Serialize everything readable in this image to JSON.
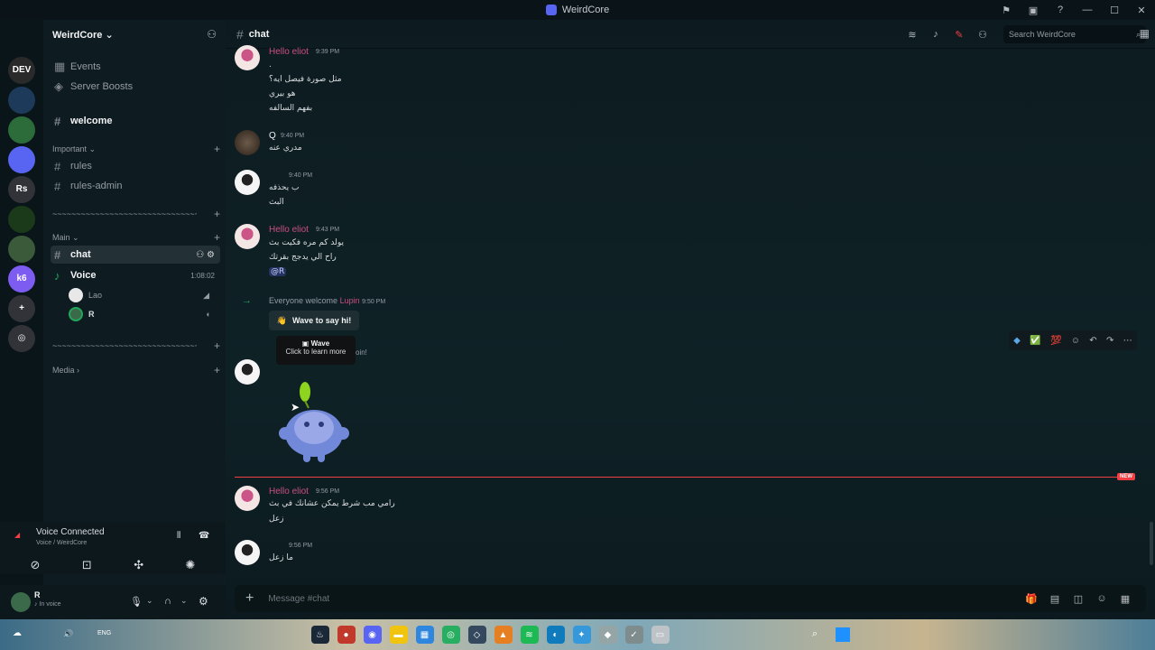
{
  "window": {
    "title": "WeirdCore"
  },
  "rail": {
    "servers": [
      {
        "name": "discord-home",
        "label": "",
        "color": "#0a1519"
      },
      {
        "name": "server-dev",
        "label": "DEV",
        "color": "#2a2a2a"
      },
      {
        "name": "server-lightning",
        "label": "",
        "color": "#1d3a5a"
      },
      {
        "name": "server-green",
        "label": "",
        "color": "#2c6b3a"
      },
      {
        "name": "server-bot",
        "label": "",
        "color": "#5865f2"
      },
      {
        "name": "server-rs",
        "label": "Rs",
        "color": "#313338"
      },
      {
        "name": "server-ring",
        "label": "",
        "color": "#1a3a1a"
      },
      {
        "name": "server-landscape",
        "label": "",
        "color": "#3a5a3a"
      },
      {
        "name": "server-k6",
        "label": "k6",
        "color": "#7d5cf2"
      },
      {
        "name": "add-server",
        "label": "+",
        "color": "#313338"
      },
      {
        "name": "explore",
        "label": "◎",
        "color": "#313338"
      }
    ]
  },
  "sidebar": {
    "guild_name": "WeirdCore",
    "events_label": "Events",
    "boosts_label": "Server Boosts",
    "welcome_label": "welcome",
    "cat_important": "Important",
    "rules_label": "rules",
    "rules_admin_label": "rules-admin",
    "cat_divider": "~~~~~~~~~~~~~~~~~~~~~~~~~~~~~~~~~~~~",
    "cat_main": "Main",
    "chat_label": "chat",
    "voice_label": "Voice",
    "voice_timer": "1:08:02",
    "voice_users": [
      {
        "name": "Lao",
        "color": "#e8e8e8"
      },
      {
        "name": "R",
        "color": "#3a6a4a"
      }
    ],
    "cat_divider2": "~~~~~~~~~~~~~~~~~~~~~~~~~~~~~~~~~~~~",
    "cat_media": "Media"
  },
  "voice_panel": {
    "title": "Voice Connected",
    "subtitle": "Voice / WeirdCore"
  },
  "user_panel": {
    "name": "R",
    "status": "In voice"
  },
  "header": {
    "channel": "chat",
    "search_placeholder": "Search WeirdCore"
  },
  "messages": [
    {
      "author": "Hello eliot",
      "time": "9:39 PM",
      "lines": [
        ".",
        "مثل صورة فيصل ايه؟",
        "هو بيري",
        "بفهم السالفه"
      ]
    },
    {
      "author": "Q",
      "time": "9:40 PM",
      "lines": [
        "مدري عنه"
      ]
    },
    {
      "author": "",
      "time": "9:40 PM",
      "lines": [
        "ب يحذفه",
        "البث"
      ]
    },
    {
      "author": "Hello eliot",
      "time": "9:43 PM",
      "lines": [
        "يولد كم مره فكيت بث",
        "راح الي يدجج بقرتك",
        "@R"
      ]
    },
    {
      "author": "",
      "time": "9:56 PM",
      "lines": [
        "رامي مب شرط يمكن عشانك في بث",
        "زعل"
      ]
    },
    {
      "author": "",
      "time": "9:56 PM",
      "lines": [
        "ما زعل"
      ]
    }
  ],
  "system": {
    "welcome_text": "Everyone welcome",
    "welcome_user": "Lupin",
    "welcome_time": "9:50 PM",
    "wave_label": "Wave to say hi!",
    "tooltip_title": "Wave",
    "tooltip_sub": "Click to learn more",
    "partial_text": "oin!"
  },
  "latest_author": "Hello eliot",
  "latest_time": "9:56 PM",
  "new_badge": "NEW",
  "composer": {
    "placeholder": "Message #chat"
  },
  "taskbar": {
    "lang": "ENG"
  }
}
